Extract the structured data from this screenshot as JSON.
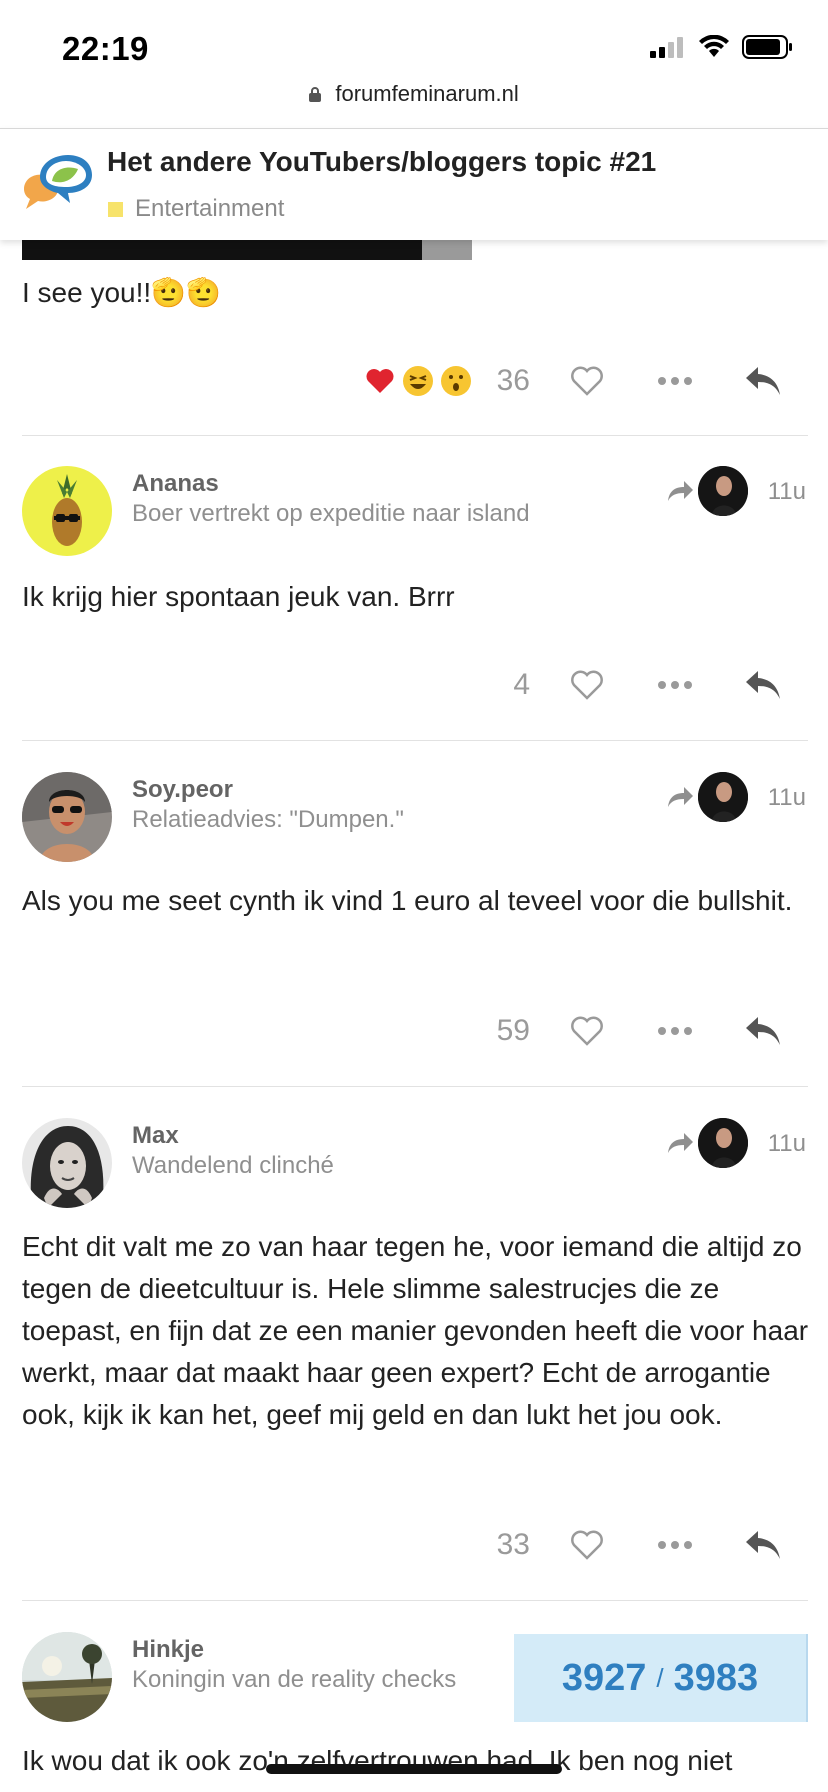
{
  "status_bar": {
    "time": "22:19"
  },
  "browser": {
    "url": "forumfeminarum.nl"
  },
  "topic": {
    "title": "Het andere YouTubers/bloggers topic #21",
    "category": "Entertainment",
    "category_color": "#f7e36b"
  },
  "posts": [
    {
      "text": "I see you!!🫡🫡",
      "reactions": [
        "heart",
        "laughing",
        "surprised"
      ],
      "like_count": "36"
    },
    {
      "username": "Ananas",
      "user_title": "Boer vertrekt op expeditie naar island",
      "date": "11u",
      "text": "Ik krijg hier spontaan jeuk van. Brrr",
      "like_count": "4"
    },
    {
      "username": "Soy.peor",
      "user_title": "Relatieadvies: \"Dumpen.\"",
      "date": "11u",
      "text": "Als you me seet cynth ik vind 1 euro al teveel voor die bullshit.",
      "like_count": "59"
    },
    {
      "username": "Max",
      "user_title": "Wandelend clinché",
      "date": "11u",
      "text": "Echt dit valt me zo van haar tegen he, voor iemand die altijd zo tegen de dieetcultuur is. Hele slimme salestrucjes die ze toepast, en fijn dat ze een manier gevonden heeft die voor haar werkt, maar dat maakt haar geen expert? Echt de arrogantie ook, kijk ik kan het, geef mij geld en dan lukt het jou ook.",
      "like_count": "33"
    },
    {
      "username": "Hinkje",
      "user_title": "Koningin van de reality checks",
      "text": "Ik wou dat ik ook zo'n zelfvertrouwen had. Ik ben nog niet"
    }
  ],
  "progress": {
    "current": "3927",
    "separator": "/",
    "total": "3983"
  },
  "colors": {
    "accent": "#2f7fc0",
    "progress_bg": "#d4ebf8",
    "muted": "#8f8f8f"
  }
}
